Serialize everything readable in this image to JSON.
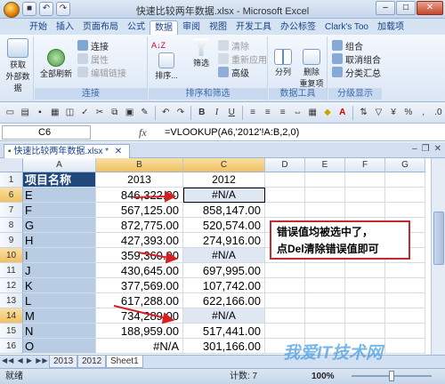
{
  "window": {
    "title": "快速比较两年数据.xlsx - Microsoft Excel"
  },
  "tabs": [
    "开始",
    "插入",
    "页面布局",
    "公式",
    "数据",
    "审阅",
    "视图",
    "开发工具",
    "办公标签",
    "Clark's Too",
    "加载项"
  ],
  "active_tab": "数据",
  "ribbon": {
    "get_external": "获取\n外部数据",
    "refresh_all": "全部刷新",
    "connections": "连接",
    "properties": "属性",
    "edit_links": "编辑链接",
    "group_connections": "连接",
    "sort_az": "A↓Z",
    "sort": "排序...",
    "filter": "筛选",
    "clear": "清除",
    "reapply": "重新应用",
    "advanced": "高级",
    "group_sort_filter": "排序和筛选",
    "text_to_columns": "分列",
    "remove_duplicates": "删除\n重复项",
    "group_data_tools": "数据工具",
    "group_combine": "组合",
    "ungroup": "取消组合",
    "subtotal": "分类汇总",
    "group_outline": "分级显示"
  },
  "formula_bar": {
    "name_box": "C6",
    "fx": "fx",
    "formula": "=VLOOKUP(A6,'2012'!A:B,2,0)"
  },
  "document_tab": "快速比较两年数据.xlsx *",
  "columns": [
    "A",
    "B",
    "C",
    "D",
    "E",
    "F",
    "G"
  ],
  "header_row": {
    "row": "1",
    "a": "项目名称",
    "b": "2013",
    "c": "2012"
  },
  "rows": [
    {
      "row": "6",
      "a": "E",
      "b": "846,322.00",
      "c": "#N/A",
      "selected": true
    },
    {
      "row": "7",
      "a": "F",
      "b": "567,125.00",
      "c": "858,147.00",
      "selected": false
    },
    {
      "row": "8",
      "a": "G",
      "b": "872,775.00",
      "c": "520,574.00",
      "selected": false
    },
    {
      "row": "9",
      "a": "H",
      "b": "427,393.00",
      "c": "274,916.00",
      "selected": false
    },
    {
      "row": "10",
      "a": "I",
      "b": "359,360.00",
      "c": "#N/A",
      "selected": true
    },
    {
      "row": "11",
      "a": "J",
      "b": "430,645.00",
      "c": "697,995.00",
      "selected": false
    },
    {
      "row": "12",
      "a": "K",
      "b": "377,569.00",
      "c": "107,742.00",
      "selected": false
    },
    {
      "row": "13",
      "a": "L",
      "b": "617,288.00",
      "c": "622,166.00",
      "selected": false
    },
    {
      "row": "14",
      "a": "M",
      "b": "734,289.00",
      "c": "#N/A",
      "selected": true
    },
    {
      "row": "15",
      "a": "N",
      "b": "188,959.00",
      "c": "517,441.00",
      "selected": false
    },
    {
      "row": "16",
      "a": "O",
      "b": "#N/A",
      "c": "301,166.00",
      "selected": false
    }
  ],
  "annotation": {
    "line1": "错误值均被选中了，",
    "line2": "点Del清除错误值即可"
  },
  "sheet_tabs": [
    "2013",
    "2012",
    "Sheet1"
  ],
  "active_sheet": "Sheet1",
  "status": {
    "ready": "就绪",
    "count": "计数: 7",
    "zoom": "100%"
  },
  "watermark": "我爱IT技术网",
  "colors": {
    "header_fill": "#1f497d",
    "col_a_fill": "#b8cce4",
    "annotation_border": "#c42a2a",
    "arrow": "#d42020"
  }
}
